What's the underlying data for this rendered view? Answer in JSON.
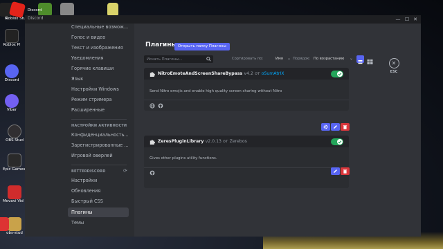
{
  "desktop": {
    "icons": [
      {
        "label": "K",
        "color": "#222"
      },
      {
        "label": "Roblox Studio",
        "color": "#e2231a"
      },
      {
        "label": "",
        "color": "#4e8c2b"
      },
      {
        "label": "Discord",
        "color": "#5865f2"
      },
      {
        "label": "",
        "color": "#888"
      },
      {
        "label": "",
        "color": "#d9d36a"
      },
      {
        "label": "Roblox Pl",
        "color": "#222"
      },
      {
        "label": "Discord",
        "color": "#5865f2"
      },
      {
        "label": "Viber",
        "color": "#7360f2"
      },
      {
        "label": "OBS Stud",
        "color": "#302e31"
      },
      {
        "label": "Epic Games Launcher",
        "color": "#2a2a2a"
      },
      {
        "label": "Movavi Vid Editor 2",
        "color": "#d02c2c"
      },
      {
        "label": "obs-stud",
        "color": "#c9a24a"
      }
    ]
  },
  "window": {
    "title": "Discord",
    "controls": {
      "minimize": "—",
      "maximize": "☐",
      "close": "✕"
    }
  },
  "sidebar": {
    "items_top": [
      {
        "label": "Специальные возмож..."
      },
      {
        "label": "Голос и видео"
      },
      {
        "label": "Текст и изображения"
      },
      {
        "label": "Уведомления"
      },
      {
        "label": "Горячие клавиши"
      },
      {
        "label": "Язык"
      },
      {
        "label": "Настройки Windows"
      },
      {
        "label": "Режим стримера"
      },
      {
        "label": "Расширенные"
      }
    ],
    "activity_header": "НАСТРОЙКИ АКТИВНОСТИ",
    "activity_items": [
      {
        "label": "Конфиденциальность..."
      },
      {
        "label": "Зарегистрированные ..."
      },
      {
        "label": "Игровой оверлей"
      }
    ],
    "bd_header": "BETTERDISCORD",
    "bd_items": [
      {
        "label": "Настройки"
      },
      {
        "label": "Обновления"
      },
      {
        "label": "Быстрый CSS"
      },
      {
        "label": "Плагины",
        "active": true
      },
      {
        "label": "Темы"
      }
    ]
  },
  "plugins_page": {
    "title": "Плагины",
    "open_folder_label": "Открыть папку Плагины",
    "search_placeholder": "Искать Плагины...",
    "sort_label": "Сортировать по:",
    "sort_value": "Имя",
    "order_label": "Порядок:",
    "order_value": "По возрастанию",
    "view_active": "list",
    "esc_label": "ESC",
    "cards": [
      {
        "name": "NitroEmoteAndScreenShareBypass",
        "version": "v4.2",
        "by": "от",
        "author": "oSumAtrIX",
        "enabled": true,
        "description": "Send Nitro emojis and enable high quality screen sharing without Nitro",
        "footer_icons": [
          "globe-icon",
          "github-icon"
        ],
        "actions": [
          "settings",
          "edit",
          "delete"
        ]
      },
      {
        "name": "ZeresPluginLibrary",
        "version": "v2.0.13",
        "by": "от",
        "author": "Zerebos",
        "enabled": true,
        "description": "Gives other plugins utility functions.",
        "footer_icons": [
          "github-icon"
        ],
        "actions": [
          "edit",
          "delete"
        ]
      }
    ]
  },
  "colors": {
    "accent": "#5865f2",
    "toggle_on": "#23a55a",
    "danger": "#da373c",
    "author_link": "#00a8fc"
  }
}
